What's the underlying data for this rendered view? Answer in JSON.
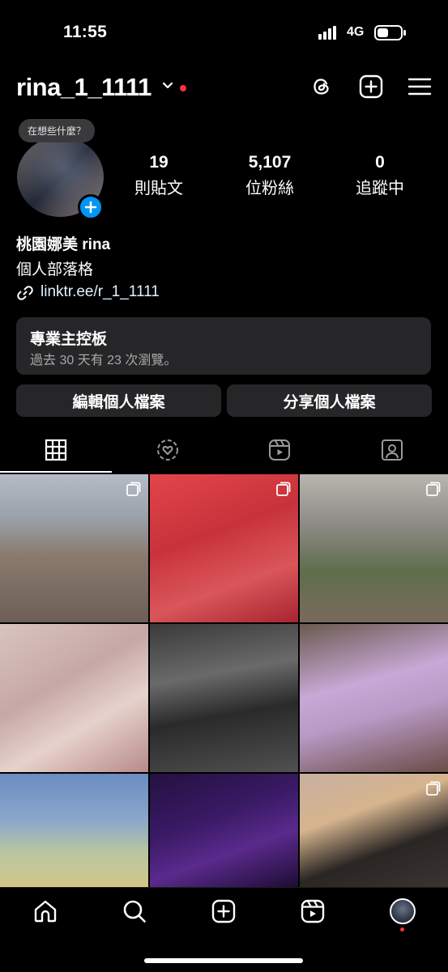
{
  "status_bar": {
    "time": "11:55",
    "network": "4G"
  },
  "header": {
    "username": "rina_1_1111"
  },
  "profile": {
    "note_bubble": "在想些什麼？",
    "stats": [
      {
        "value": "19",
        "label": "則貼文"
      },
      {
        "value": "5,107",
        "label": "位粉絲"
      },
      {
        "value": "0",
        "label": "追蹤中"
      }
    ],
    "full_name": "桃園娜美 rina",
    "category": "個人部落格",
    "link": "linktr.ee/r_1_1111"
  },
  "dashboard": {
    "title": "專業主控板",
    "subtitle": "過去 30 天有 23 次瀏覽。"
  },
  "buttons": {
    "edit_profile": "編輯個人檔案",
    "share_profile": "分享個人檔案"
  },
  "colors": {
    "accent_blue": "#0095f6",
    "notification_red": "#ff3040",
    "card_bg": "#262628"
  },
  "icons": {
    "header": [
      "threads-icon",
      "create-icon",
      "menu-icon"
    ],
    "tabs": [
      "grid-icon",
      "heart-circle-icon",
      "reels-icon",
      "tagged-icon"
    ],
    "nav": [
      "home-icon",
      "search-icon",
      "create-icon",
      "reels-icon",
      "profile-avatar"
    ]
  }
}
